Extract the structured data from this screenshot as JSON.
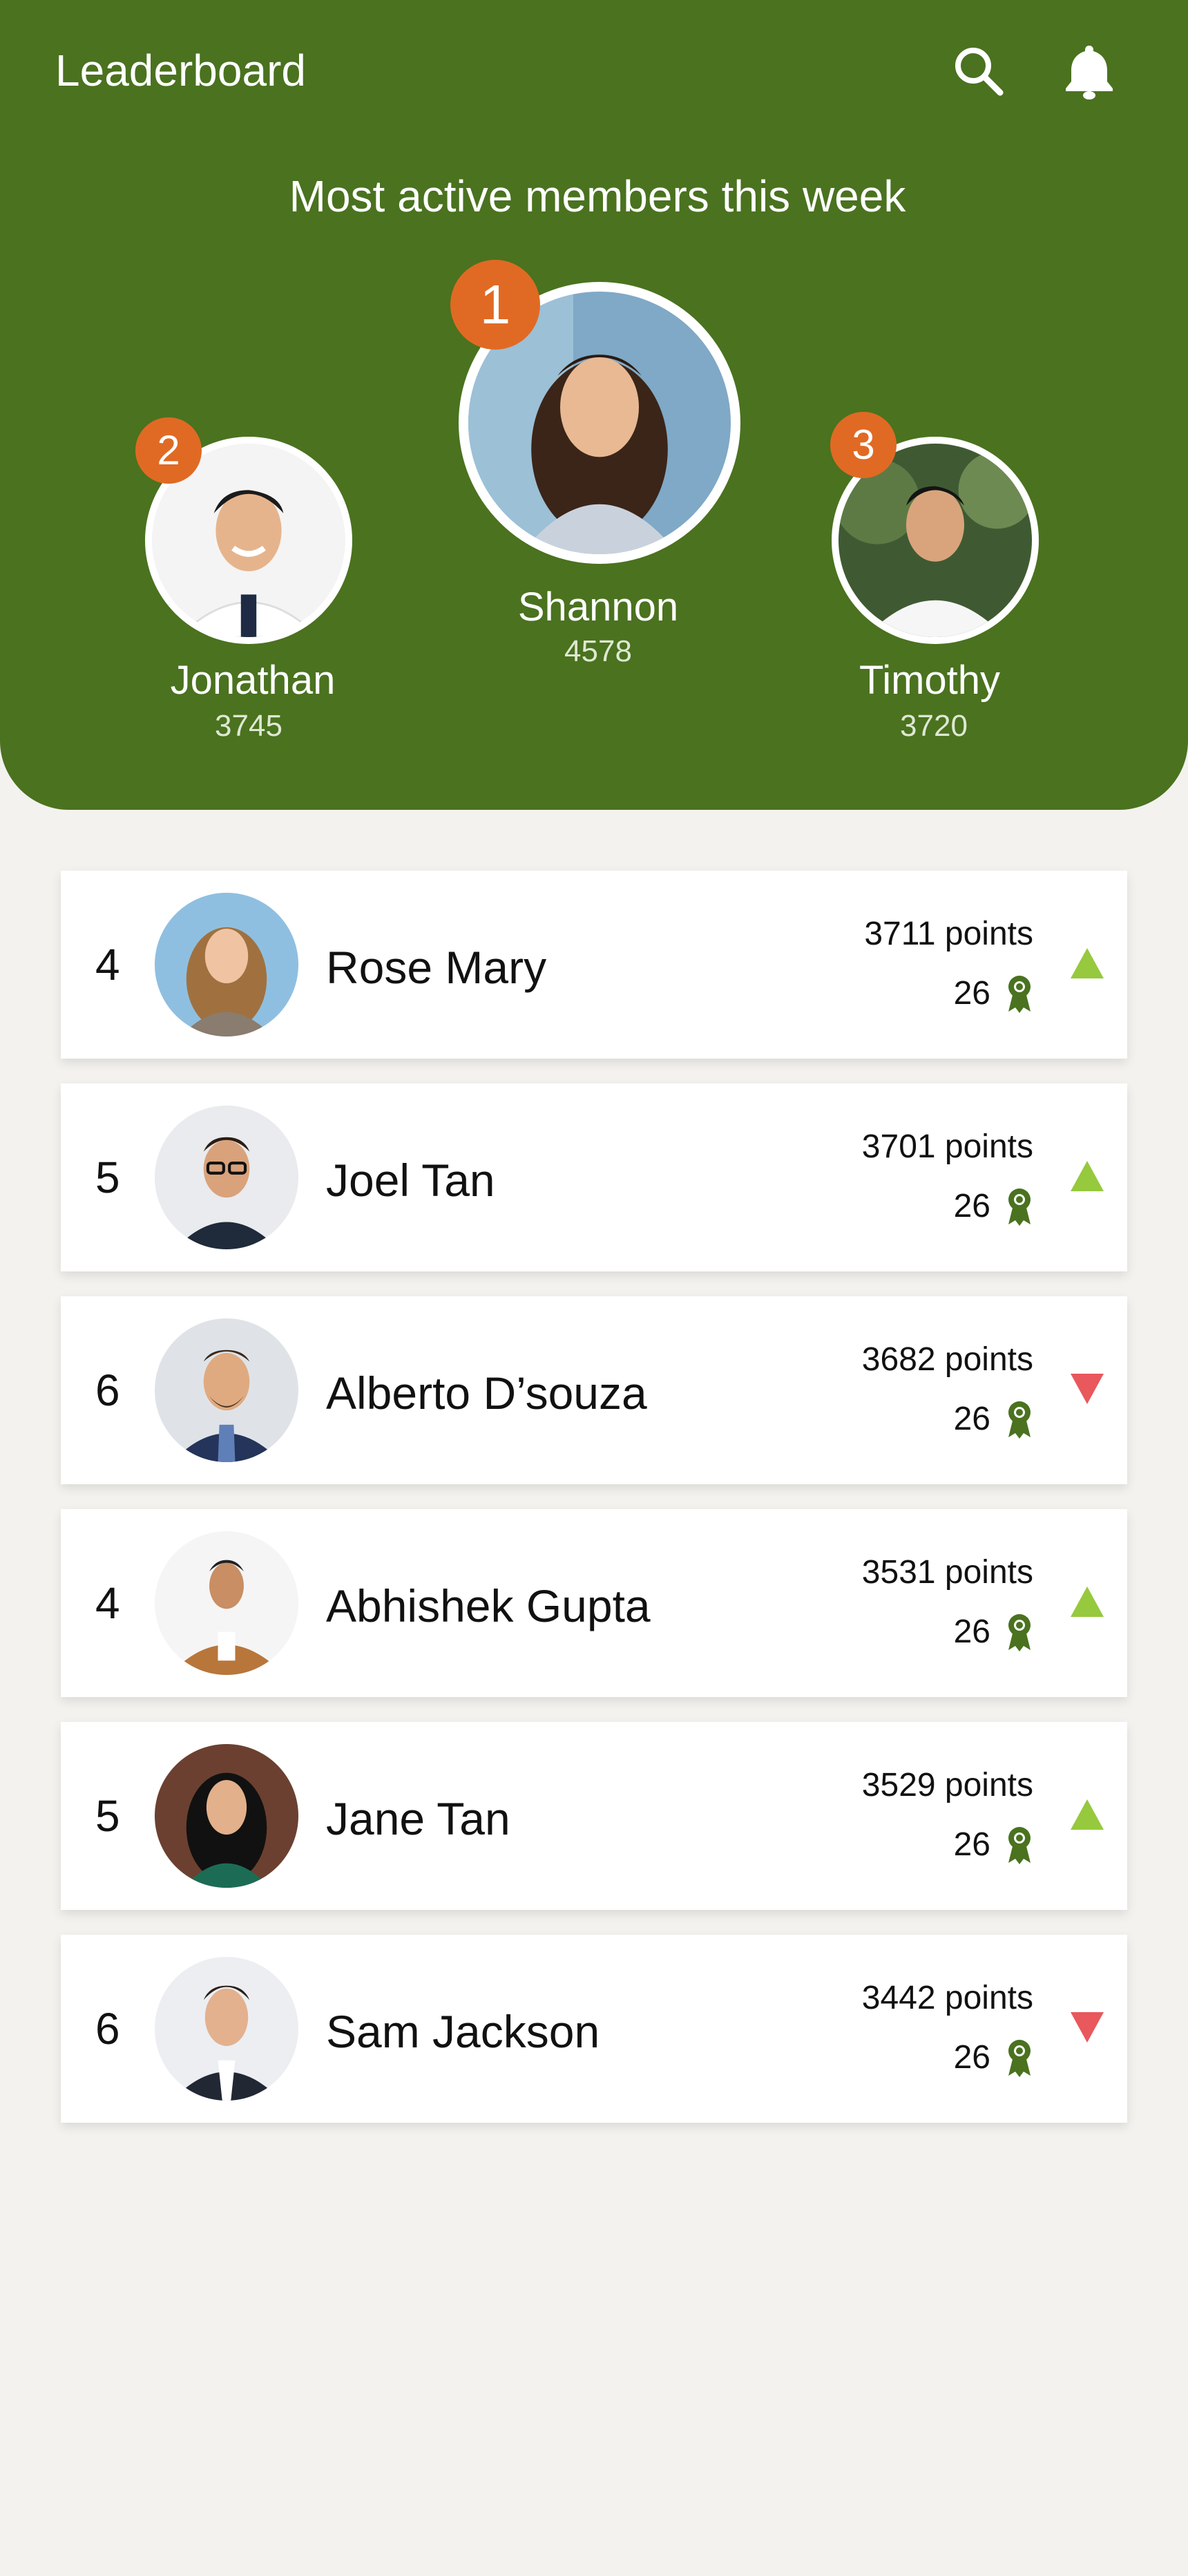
{
  "header": {
    "title": "Leaderboard",
    "search_icon": "search-icon",
    "bell_icon": "bell-icon",
    "subtitle": "Most active members this week"
  },
  "podium": [
    {
      "rank": "1",
      "name": "Shannon",
      "score": "4578"
    },
    {
      "rank": "2",
      "name": "Jonathan",
      "score": "3745"
    },
    {
      "rank": "3",
      "name": "Timothy",
      "score": "3720"
    }
  ],
  "list": [
    {
      "rank": "4",
      "name": "Rose Mary",
      "points": "3711 points",
      "badges": "26",
      "trend": "up"
    },
    {
      "rank": "5",
      "name": "Joel Tan",
      "points": "3701 points",
      "badges": "26",
      "trend": "up"
    },
    {
      "rank": "6",
      "name": "Alberto D’souza",
      "points": "3682 points",
      "badges": "26",
      "trend": "down"
    },
    {
      "rank": "4",
      "name": "Abhishek Gupta",
      "points": "3531 points",
      "badges": "26",
      "trend": "up"
    },
    {
      "rank": "5",
      "name": "Jane Tan",
      "points": "3529 points",
      "badges": "26",
      "trend": "up"
    },
    {
      "rank": "6",
      "name": "Sam Jackson",
      "points": "3442 points",
      "badges": "26",
      "trend": "down"
    }
  ],
  "colors": {
    "header_green": "#4a721f",
    "rank_badge": "#e06a23",
    "trend_up": "#96c93d",
    "trend_down": "#e8585c",
    "award_icon": "#4a721f",
    "background": "#f3f2ee"
  }
}
